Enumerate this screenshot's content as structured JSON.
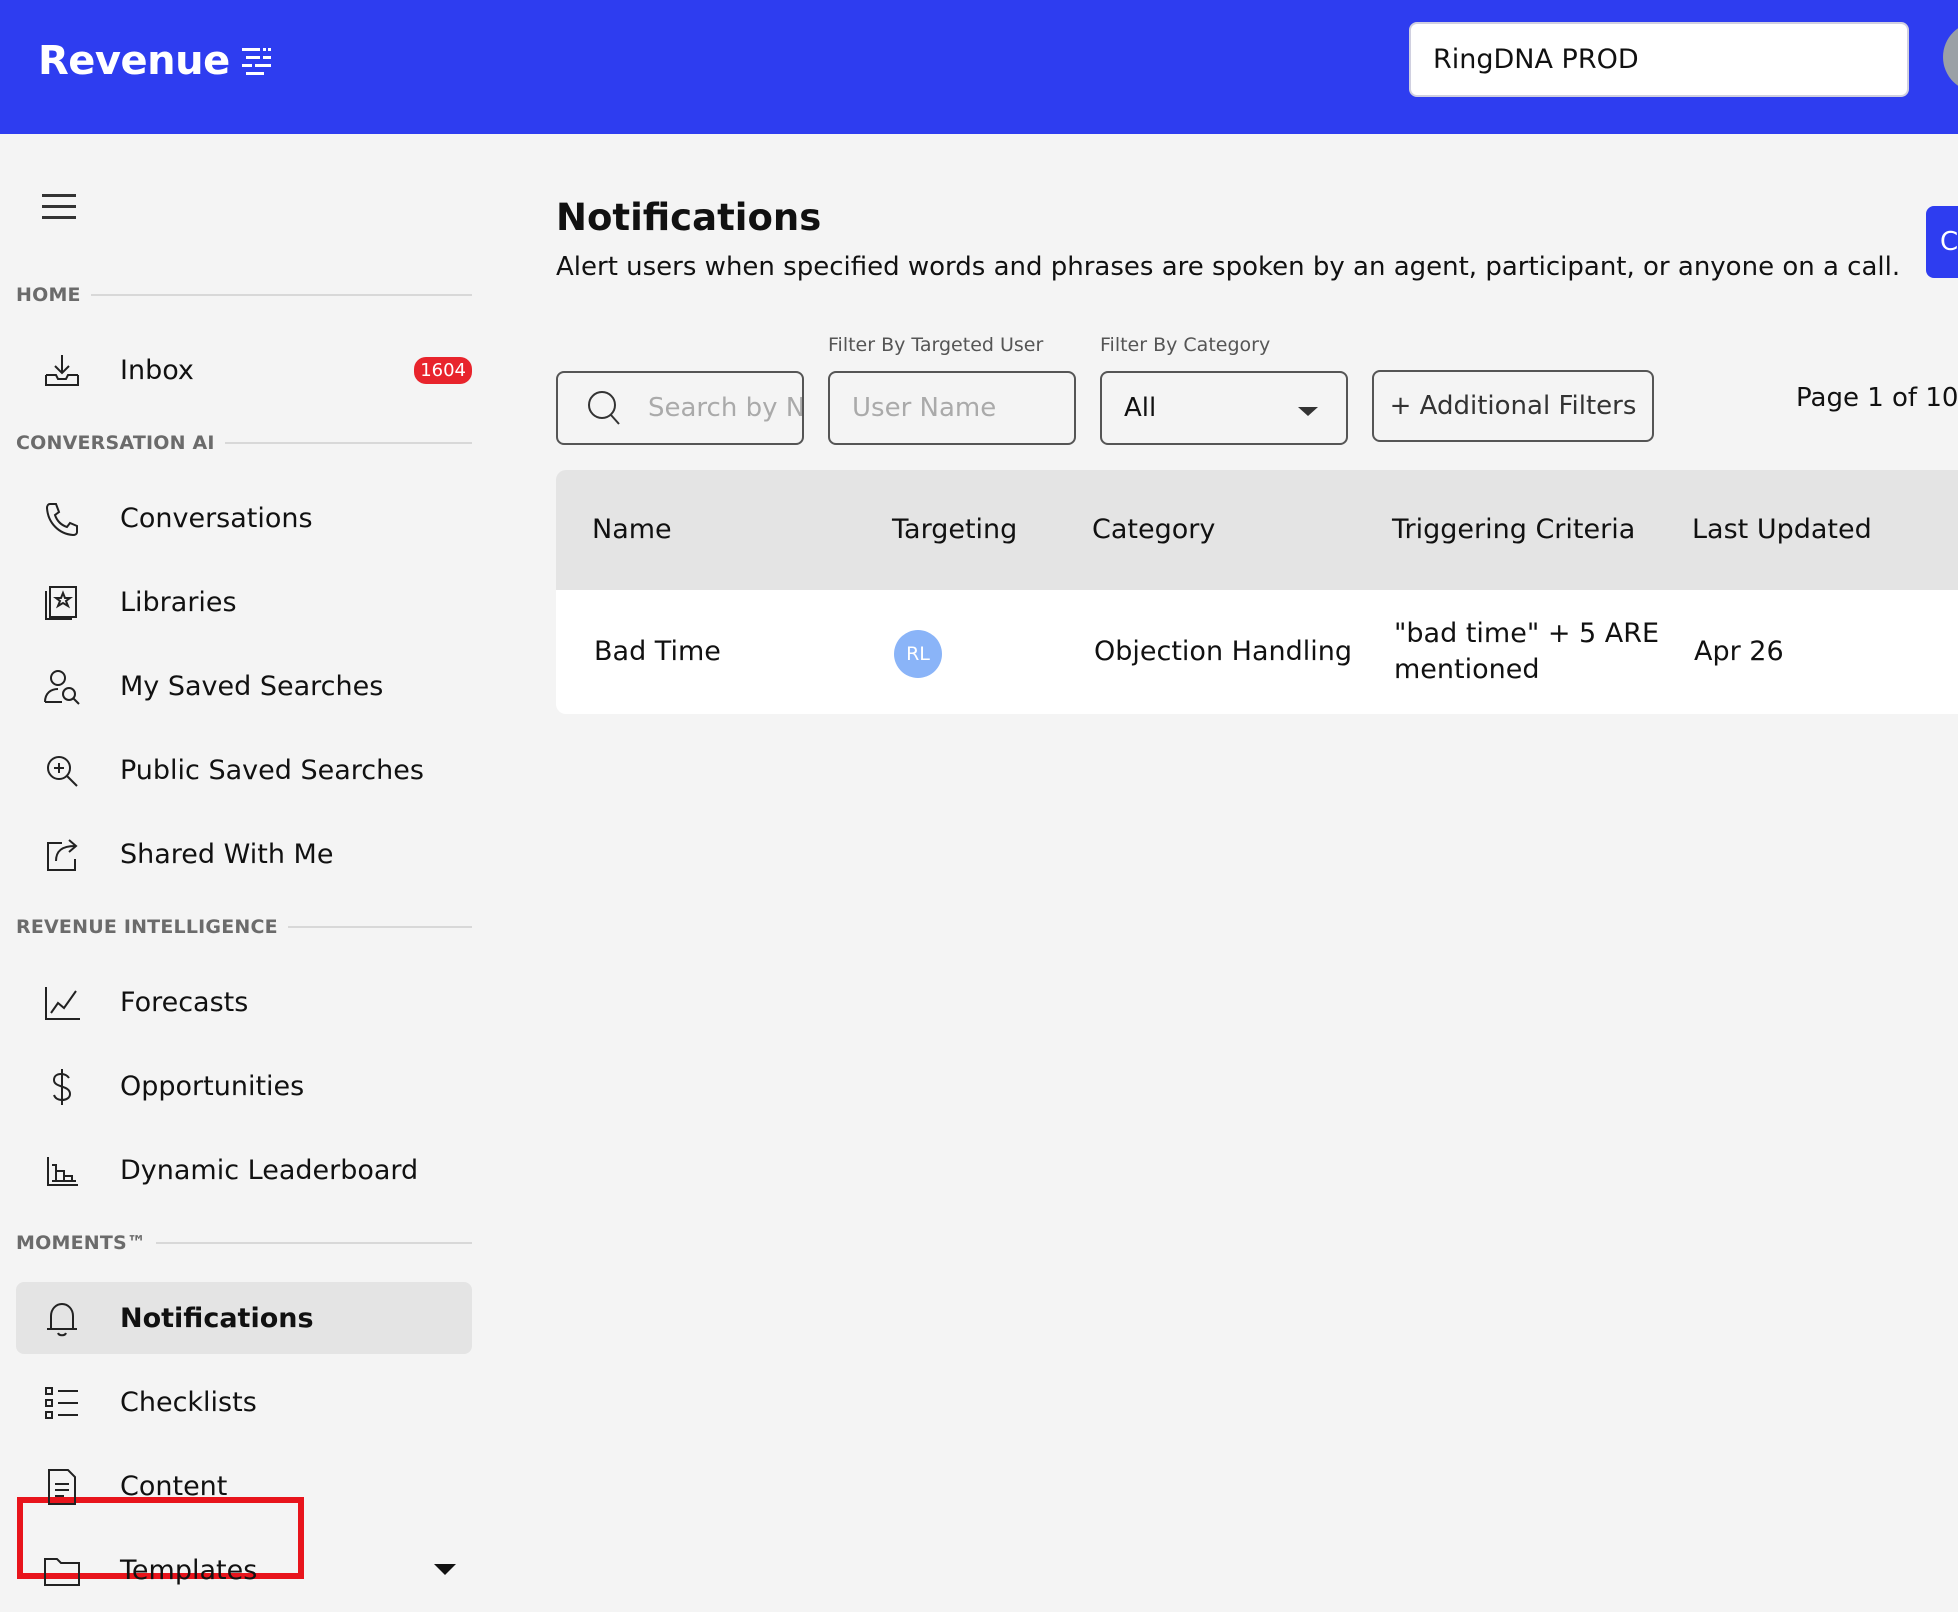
{
  "header": {
    "logo_text": "Revenue",
    "org_value": "RingDNA PROD"
  },
  "sidebar": {
    "sections": {
      "home": "HOME",
      "conversation_ai": "CONVERSATION AI",
      "revenue_intelligence": "REVENUE INTELLIGENCE",
      "moments": "MOMENTS™"
    },
    "items": {
      "inbox": {
        "label": "Inbox",
        "badge": "1604",
        "icon": "inbox-icon"
      },
      "conversations": {
        "label": "Conversations",
        "icon": "phone-icon"
      },
      "libraries": {
        "label": "Libraries",
        "icon": "library-icon"
      },
      "my_saved_searches": {
        "label": "My Saved Searches",
        "icon": "user-search-icon"
      },
      "public_saved_searches": {
        "label": "Public Saved Searches",
        "icon": "zoom-in-icon"
      },
      "shared_with_me": {
        "label": "Shared With Me",
        "icon": "share-icon"
      },
      "forecasts": {
        "label": "Forecasts",
        "icon": "line-chart-icon"
      },
      "opportunities": {
        "label": "Opportunities",
        "icon": "dollar-icon"
      },
      "dynamic_leaderboard": {
        "label": "Dynamic Leaderboard",
        "icon": "bar-chart-icon"
      },
      "notifications": {
        "label": "Notifications",
        "icon": "bell-icon"
      },
      "checklists": {
        "label": "Checklists",
        "icon": "checklist-icon"
      },
      "content": {
        "label": "Content",
        "icon": "document-icon"
      },
      "templates": {
        "label": "Templates",
        "icon": "folder-icon"
      }
    }
  },
  "main": {
    "title": "Notifications",
    "subtitle": "Alert users when specified words and phrases are spoken by an agent, participant, or anyone on a call.",
    "create_label": "C",
    "filters": {
      "search_placeholder": "Search by N",
      "targeted_user_label": "Filter By Targeted User",
      "user_placeholder": "User Name",
      "category_label": "Filter By Category",
      "category_value": "All",
      "additional_filters": "+ Additional Filters"
    },
    "pager": "Page 1 of 10",
    "table": {
      "columns": [
        "Name",
        "Targeting",
        "Category",
        "Triggering Criteria",
        "Last Updated"
      ],
      "rows": [
        {
          "name": "Bad Time",
          "targeting": "RL",
          "category": "Objection Handling",
          "criteria_line1": "\"bad time\" + 5 ARE",
          "criteria_line2": "mentioned",
          "updated": "Apr 26"
        }
      ]
    }
  },
  "colors": {
    "brand": "#2e3df0",
    "badge": "#e8242c",
    "highlight": "#e8141c",
    "avatar": "#8ab4f8"
  }
}
